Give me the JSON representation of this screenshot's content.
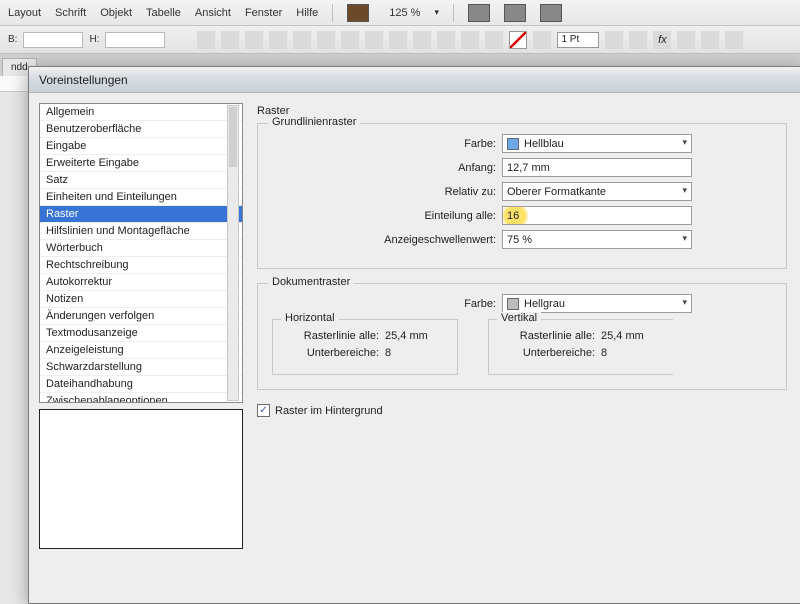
{
  "menubar": {
    "items": [
      "Layout",
      "Schrift",
      "Objekt",
      "Tabelle",
      "Ansicht",
      "Fenster",
      "Hilfe"
    ],
    "zoom": "125 %"
  },
  "toolbar2": {
    "b": "B:",
    "h": "H:",
    "pt": "1 Pt"
  },
  "tab": "ndd",
  "dialog": {
    "title": "Voreinstellungen",
    "sidebar_items": [
      "Allgemein",
      "Benutzeroberfläche",
      "Eingabe",
      "Erweiterte Eingabe",
      "Satz",
      "Einheiten und Einteilungen",
      "Raster",
      "Hilfslinien und Montagefläche",
      "Wörterbuch",
      "Rechtschreibung",
      "Autokorrektur",
      "Notizen",
      "Änderungen verfolgen",
      "Textmodusanzeige",
      "Anzeigeleistung",
      "Schwarzdarstellung",
      "Dateihandhabung",
      "Zwischenablageoptionen"
    ],
    "sidebar_selected_index": 6,
    "heading": "Raster",
    "grundlinien": {
      "legend": "Grundlinienraster",
      "farbe_label": "Farbe:",
      "farbe_value": "Hellblau",
      "farbe_swatch": "#6aa8e8",
      "anfang_label": "Anfang:",
      "anfang_value": "12,7 mm",
      "relativ_label": "Relativ zu:",
      "relativ_value": "Oberer Formatkante",
      "einteilung_label": "Einteilung alle:",
      "einteilung_value": "16",
      "schwelle_label": "Anzeigeschwellenwert:",
      "schwelle_value": "75 %"
    },
    "dokument": {
      "legend": "Dokumentraster",
      "farbe_label": "Farbe:",
      "farbe_value": "Hellgrau",
      "farbe_swatch": "#bdbdbd",
      "horizontal": {
        "legend": "Horizontal",
        "rasterlinie_label": "Rasterlinie alle:",
        "rasterlinie_value": "25,4 mm",
        "unter_label": "Unterbereiche:",
        "unter_value": "8"
      },
      "vertikal": {
        "legend": "Vertikal",
        "rasterlinie_label": "Rasterlinie alle:",
        "rasterlinie_value": "25,4 mm",
        "unter_label": "Unterbereiche:",
        "unter_value": "8"
      }
    },
    "hintergrund_label": "Raster im Hintergrund",
    "hintergrund_checked": true
  }
}
